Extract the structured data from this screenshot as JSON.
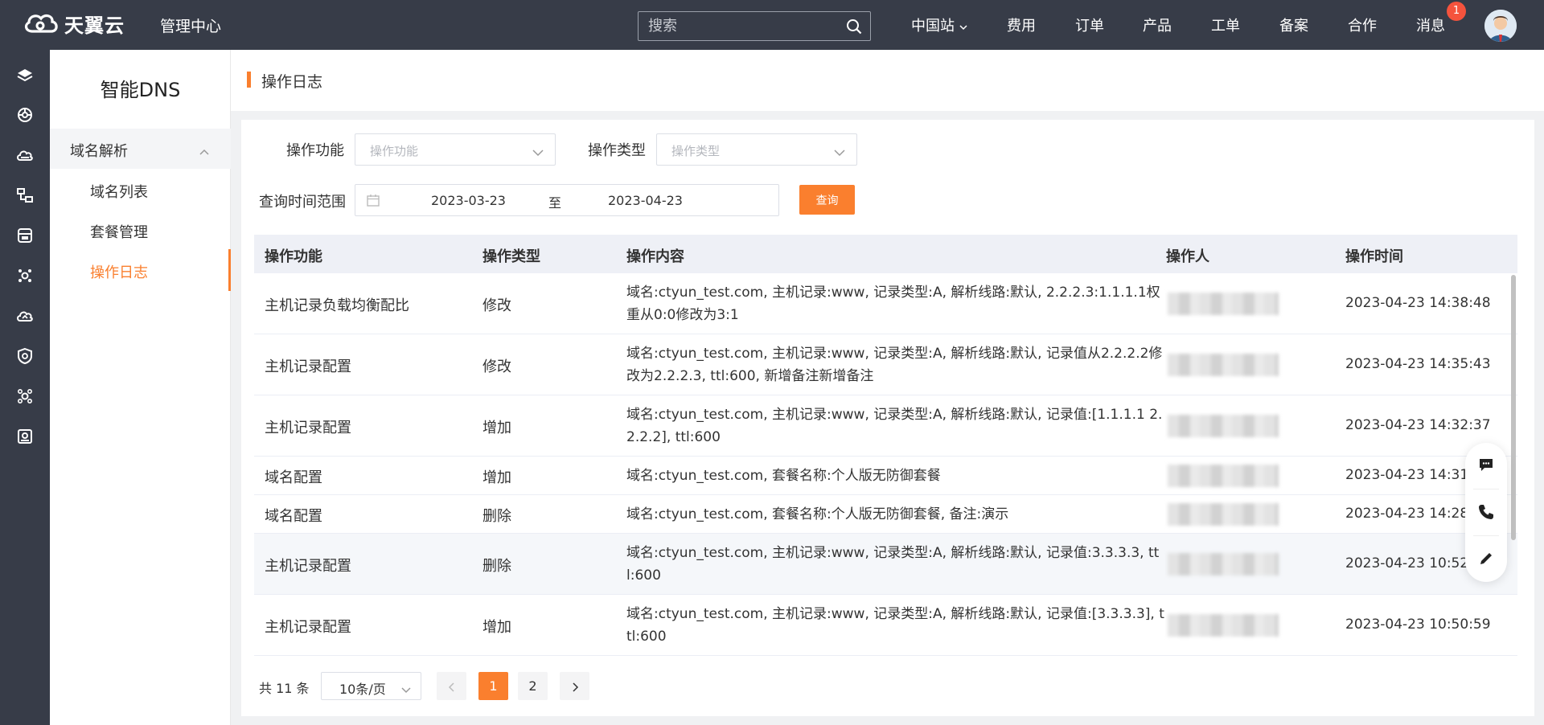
{
  "brand": {
    "name": "天翼云",
    "center": "管理中心",
    "accent": "#fa7f2e",
    "topbar_bg": "#373c48"
  },
  "search": {
    "placeholder": "搜索"
  },
  "nav": {
    "region": "中国站",
    "items": [
      "费用",
      "订单",
      "产品",
      "工单",
      "备案",
      "合作",
      "消息"
    ],
    "message_count": "1"
  },
  "rail_icons": [
    "layers-icon",
    "ring-icon",
    "cloud-icon",
    "network-icon",
    "monitor-icon",
    "settings-icon",
    "cloud-sync-icon",
    "shield-icon",
    "cluster-icon",
    "report-icon"
  ],
  "sidebar": {
    "title": "智能DNS",
    "group": "域名解析",
    "items": [
      {
        "label": "域名列表",
        "active": false
      },
      {
        "label": "套餐管理",
        "active": false
      },
      {
        "label": "操作日志",
        "active": true
      }
    ]
  },
  "page": {
    "title": "操作日志"
  },
  "filters": {
    "func_label": "操作功能",
    "func_placeholder": "操作功能",
    "type_label": "操作类型",
    "type_placeholder": "操作类型",
    "range_label": "查询时间范围",
    "start_date": "2023-03-23",
    "separator": "至",
    "end_date": "2023-04-23",
    "query_button": "查询"
  },
  "table": {
    "columns": [
      "操作功能",
      "操作类型",
      "操作内容",
      "操作人",
      "操作时间"
    ],
    "rows": [
      {
        "func": "主机记录负载均衡配比",
        "type": "修改",
        "content": "域名:ctyun_test.com, 主机记录:www, 记录类型:A, 解析线路:默认, 2.2.2.3:1.1.1.1权重从0:0修改为3:1",
        "time": "2023-04-23 14:38:48"
      },
      {
        "func": "主机记录配置",
        "type": "修改",
        "content": "域名:ctyun_test.com, 主机记录:www, 记录类型:A, 解析线路:默认, 记录值从2.2.2.2修改为2.2.2.3, ttl:600, 新增备注新增备注",
        "time": "2023-04-23 14:35:43"
      },
      {
        "func": "主机记录配置",
        "type": "增加",
        "content": "域名:ctyun_test.com, 主机记录:www, 记录类型:A, 解析线路:默认, 记录值:[1.1.1.1 2.2.2.2], ttl:600",
        "time": "2023-04-23 14:32:37"
      },
      {
        "func": "域名配置",
        "type": "增加",
        "content": "域名:ctyun_test.com, 套餐名称:个人版无防御套餐",
        "time": "2023-04-23 14:31:12"
      },
      {
        "func": "域名配置",
        "type": "删除",
        "content": "域名:ctyun_test.com, 套餐名称:个人版无防御套餐, 备注:演示",
        "time": "2023-04-23 14:28:40"
      },
      {
        "func": "主机记录配置",
        "type": "删除",
        "content": "域名:ctyun_test.com, 主机记录:www, 记录类型:A, 解析线路:默认, 记录值:3.3.3.3, ttl:600",
        "time": "2023-04-23 10:52:27"
      },
      {
        "func": "主机记录配置",
        "type": "增加",
        "content": "域名:ctyun_test.com, 主机记录:www, 记录类型:A, 解析线路:默认, 记录值:[3.3.3.3], ttl:600",
        "time": "2023-04-23 10:50:59"
      }
    ]
  },
  "pagination": {
    "total": "共 11 条",
    "page_size": "10条/页",
    "pages": [
      "1",
      "2"
    ],
    "current": "1"
  },
  "float_tools": [
    "chat-icon",
    "phone-icon",
    "edit-icon"
  ]
}
